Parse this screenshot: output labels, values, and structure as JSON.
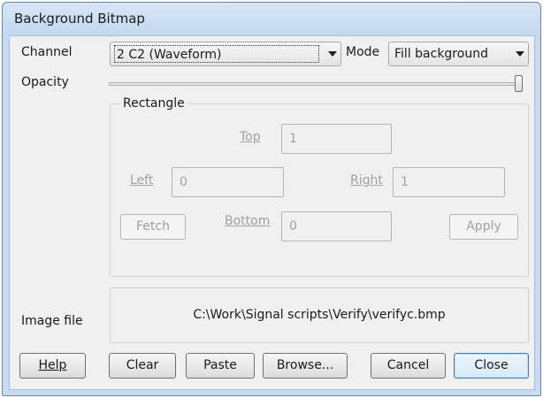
{
  "window": {
    "title": "Background Bitmap"
  },
  "channel": {
    "label": "Channel",
    "value": "2 C2 (Waveform)"
  },
  "mode": {
    "label": "Mode",
    "value": "Fill background"
  },
  "opacity": {
    "label": "Opacity",
    "level_fraction": 1.0
  },
  "rectangle": {
    "label": "Rectangle",
    "top": {
      "label": "Top",
      "value": "1"
    },
    "left": {
      "label": "Left",
      "value": "0"
    },
    "right": {
      "label": "Right",
      "value": "1"
    },
    "bottom": {
      "label": "Bottom",
      "value": "0"
    },
    "fetch_label": "Fetch",
    "apply_label": "Apply"
  },
  "image_file": {
    "label": "Image file",
    "path": "C:\\Work\\Signal scripts\\Verify\\verifyc.bmp"
  },
  "buttons": {
    "help": "Help",
    "clear": "Clear",
    "paste": "Paste",
    "browse": "Browse...",
    "cancel": "Cancel",
    "close": "Close"
  }
}
